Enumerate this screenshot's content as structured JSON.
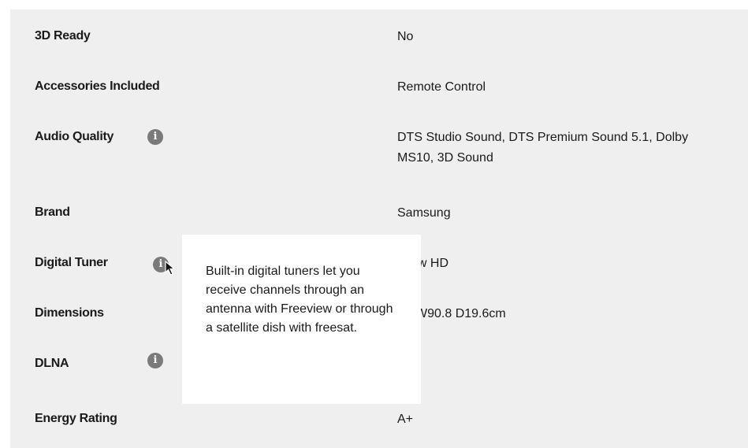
{
  "specs": [
    {
      "label": "3D Ready",
      "value": "No",
      "has_info": false
    },
    {
      "label": "Accessories Included",
      "value": "Remote Control",
      "has_info": false
    },
    {
      "label": "Audio Quality",
      "value": "DTS Studio Sound, DTS Premium Sound 5.1, Dolby MS10, 3D Sound",
      "has_info": true
    },
    {
      "label": "Brand",
      "value": "Samsung",
      "has_info": false
    },
    {
      "label": "Digital Tuner",
      "value": "ew HD",
      "has_info": true
    },
    {
      "label": "Dimensions",
      "value": "W90.8 D19.6cm",
      "has_info": false
    },
    {
      "label": "DLNA",
      "value": "",
      "has_info": true
    },
    {
      "label": "Energy Rating",
      "value": "A+",
      "has_info": false
    }
  ],
  "info_glyph": "i",
  "tooltip": {
    "text": "Built-in digital tuners let you receive channels through an antenna with Freeview or through a satellite dish with freesat."
  },
  "colors": {
    "panel_bg": "#efefef",
    "info_icon": "#7a7a7a",
    "tooltip_bg": "#ffffff"
  }
}
